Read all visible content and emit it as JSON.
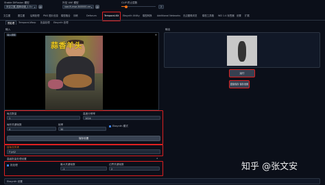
{
  "header": {
    "model_label": "Stable Diffusion 模型",
    "model_value": "天空之翼_国风动漫_1.5.safetensors [...]",
    "vae_label": "外挂 VAE 模型",
    "vae_value": "vae-ft-mse-840000-ema-pruned.safetensors",
    "clip_label": "CLIP 终止层数",
    "clip_value": "2"
  },
  "tabs": [
    "文生图",
    "图生图",
    "后期处理",
    "PNG 图片信息",
    "模型融合",
    "训练",
    "Deforum",
    "Temporal-Kit",
    "Ebsynth Utility",
    "模型转换",
    "Additional Networks",
    "无边图像浏览",
    "模型工具箱",
    "WD 1.4 标签器",
    "设置",
    "扩展"
  ],
  "active_tab": "Temporal-Kit",
  "subtabs": [
    "预处理",
    "Temporal-Warp",
    "批量处理",
    "Ebsynth 处理"
  ],
  "input_panel": {
    "title": "输入",
    "video_label": "输入视频",
    "caption_top": "蒜香羊头"
  },
  "output_panel": {
    "title": "输出",
    "run_button": "运行",
    "save_button": "直接保存 保存设置"
  },
  "settings": {
    "sides_label": "每边数量",
    "sides_value": "1",
    "height_label": "高度分辨率",
    "height_value": "1024",
    "fps_label": "每秒关键帧数",
    "fps_value": "4",
    "frames_label": "帧率",
    "frames_value": "30",
    "ebsynth_label": "Ebsynth 模式",
    "ebsynth_checked": true,
    "save_settings_button": "保存设置"
  },
  "target_folder": {
    "label": "目标文件夹",
    "value": "F:\\zl\\2"
  },
  "batch": {
    "header": "高级批量处理设置",
    "batch_label": "批处理",
    "batch_checked": true,
    "max_keyframes_label": "最大关键帧数",
    "max_keyframes_value": "-1",
    "border_frames_label": "边界关键帧数",
    "border_frames_value": "2"
  },
  "footer": {
    "ebsynth_settings": "Ebsynth 设置"
  },
  "watermark": "知乎 @张文安"
}
